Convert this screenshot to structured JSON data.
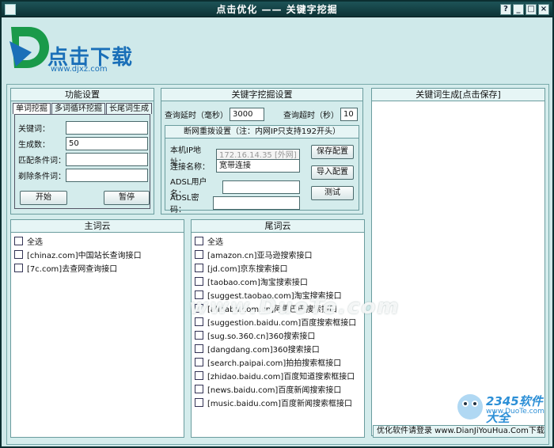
{
  "window": {
    "title": "点击优化 —— 关键字挖掘"
  },
  "logo": {
    "text": "点击下载",
    "url": "www.djxz.com"
  },
  "func_panel": {
    "title": "功能设置",
    "tabs": [
      "单词挖掘",
      "多词循环挖掘",
      "长尾词生成"
    ],
    "fields": [
      {
        "label": "关键词：",
        "value": ""
      },
      {
        "label": "生成数：",
        "value": "50"
      },
      {
        "label": "匹配条件词：",
        "value": ""
      },
      {
        "label": "剃除条件词：",
        "value": ""
      }
    ],
    "start_label": "开始",
    "pause_label": "暂停"
  },
  "mining_panel": {
    "title": "关键字挖掘设置",
    "delay_label": "查询延时（毫秒）",
    "delay_value": "3000",
    "timeout_label": "查询超时（秒）",
    "timeout_value": "10",
    "redial": {
      "title": "断网重拨设置（注：内网IP只支持192开头）",
      "ip_label": "本机IP地址：",
      "ip_value": "172.16.14.35 [外网]",
      "conn_label": "连接名称：",
      "conn_value": "宽带连接",
      "user_label": "ADSL用户名：",
      "user_value": "",
      "pwd_label": "ADSL密码：",
      "pwd_value": "",
      "save_label": "保存配置",
      "import_label": "导入配置",
      "test_label": "测试"
    }
  },
  "result_panel": {
    "title": "关键词生成[点击保存]"
  },
  "main_cloud": {
    "title": "主词云",
    "items": [
      "全选",
      "[chinaz.com]中国站长查询接口",
      "[7c.com]去查网查询接口"
    ]
  },
  "tail_cloud": {
    "title": "尾词云",
    "items": [
      "全选",
      "[amazon.cn]亚马逊搜索接口",
      "[jd.com]京东搜索接口",
      "[taobao.com]淘宝搜索接口",
      "[suggest.taobao.com]淘宝搜索接口",
      "[alibaba.com.cn]阿里巴巴搜索接口",
      "[suggestion.baidu.com]百度搜索框接口",
      "[sug.so.360.cn]360搜索接口",
      "[dangdang.com]360搜索接口",
      "[search.paipai.com]拍拍搜索框接口",
      "[zhidao.baidu.com]百度知道搜索框接口",
      "[news.baidu.com]百度新闻搜索接口",
      "[music.baidu.com]百度新闻搜索框接口"
    ]
  },
  "status": {
    "text": "优化软件请登录 www.DianJiYouHua.Com下载使"
  },
  "watermark": {
    "text": "www.DuoTe.com",
    "brand": "2345软件大全",
    "url": "www.DuoTe.com"
  },
  "colors": {
    "accent": "#1a6fb8",
    "titlebar": "#0d3336",
    "bg": "#cfe9ea"
  }
}
